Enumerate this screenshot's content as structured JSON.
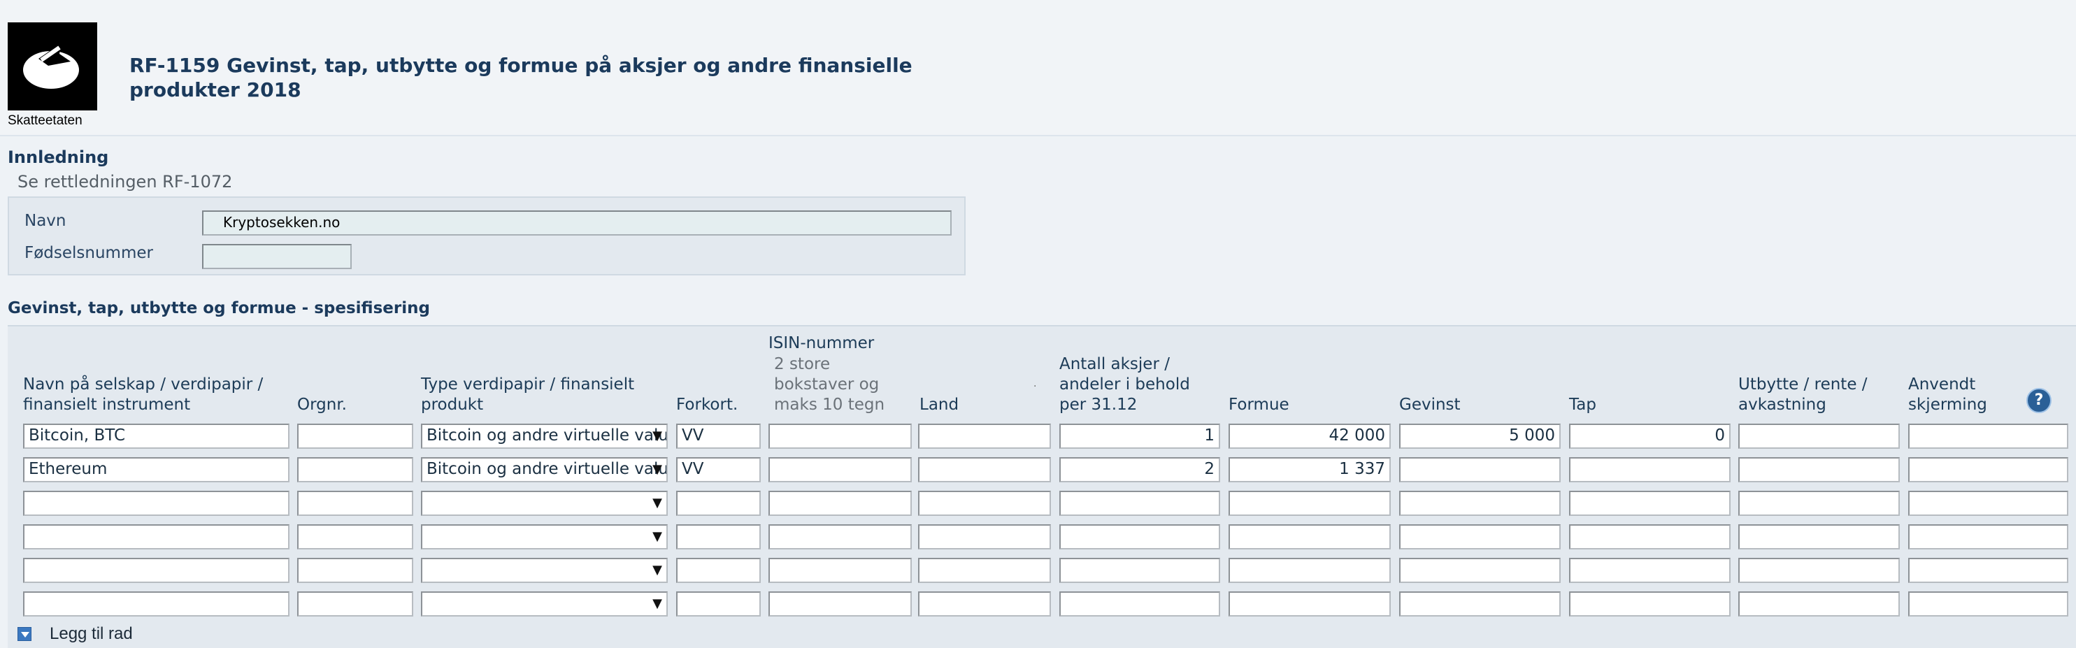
{
  "header": {
    "logo_text": "Skatteetaten",
    "title": "RF-1159 Gevinst, tap, utbytte og formue på aksjer og andre finansielle produkter 2018"
  },
  "intro": {
    "heading": "Innledning",
    "note": "Se rettledningen RF-1072",
    "name_label": "Navn",
    "name_value": "Kryptosekken.no",
    "ssn_label": "Fødselsnummer",
    "ssn_value": ""
  },
  "spec": {
    "heading": "Gevinst, tap, utbytte og formue - spesifisering",
    "columns": {
      "company": "Navn på selskap / verdipapir / finansielt instrument",
      "orgnr": "Orgnr.",
      "type": "Type verdipapir / finansielt produkt",
      "abbr": "Forkort.",
      "isin": "ISIN-nummer",
      "isin_hint": "2 store bokstaver og maks 10 tegn",
      "country": "Land",
      "shares": "Antall aksjer / andeler i behold per 31.12",
      "wealth": "Formue",
      "gain": "Gevinst",
      "loss": "Tap",
      "dividend": "Utbytte / rente / avkastning",
      "shield": "Anvendt skjerming"
    },
    "help_icon": "help-icon",
    "rows": [
      {
        "company": "Bitcoin, BTC",
        "orgnr": "",
        "type": "Bitcoin og andre virtuelle valutaer",
        "abbr": "VV",
        "isin": "",
        "country": "",
        "shares": "1",
        "wealth": "42 000",
        "gain": "5 000",
        "loss": "0",
        "dividend": "",
        "shield": ""
      },
      {
        "company": "Ethereum",
        "orgnr": "",
        "type": "Bitcoin og andre virtuelle valutaer",
        "abbr": "VV",
        "isin": "",
        "country": "",
        "shares": "2",
        "wealth": "1 337",
        "gain": "",
        "loss": "",
        "dividend": "",
        "shield": ""
      },
      {
        "company": "",
        "orgnr": "",
        "type": "",
        "abbr": "",
        "isin": "",
        "country": "",
        "shares": "",
        "wealth": "",
        "gain": "",
        "loss": "",
        "dividend": "",
        "shield": ""
      },
      {
        "company": "",
        "orgnr": "",
        "type": "",
        "abbr": "",
        "isin": "",
        "country": "",
        "shares": "",
        "wealth": "",
        "gain": "",
        "loss": "",
        "dividend": "",
        "shield": ""
      },
      {
        "company": "",
        "orgnr": "",
        "type": "",
        "abbr": "",
        "isin": "",
        "country": "",
        "shares": "",
        "wealth": "",
        "gain": "",
        "loss": "",
        "dividend": "",
        "shield": ""
      },
      {
        "company": "",
        "orgnr": "",
        "type": "",
        "abbr": "",
        "isin": "",
        "country": "",
        "shares": "",
        "wealth": "",
        "gain": "",
        "loss": "",
        "dividend": "",
        "shield": ""
      }
    ],
    "add_row_label": "Legg til rad",
    "add_row_icon": "expand-down-icon",
    "select_arrow": "▼",
    "help_glyph": "?"
  },
  "colors": {
    "title": "#1b3a5c",
    "panel": "#e3e9ef",
    "help": "#2a5f97"
  }
}
